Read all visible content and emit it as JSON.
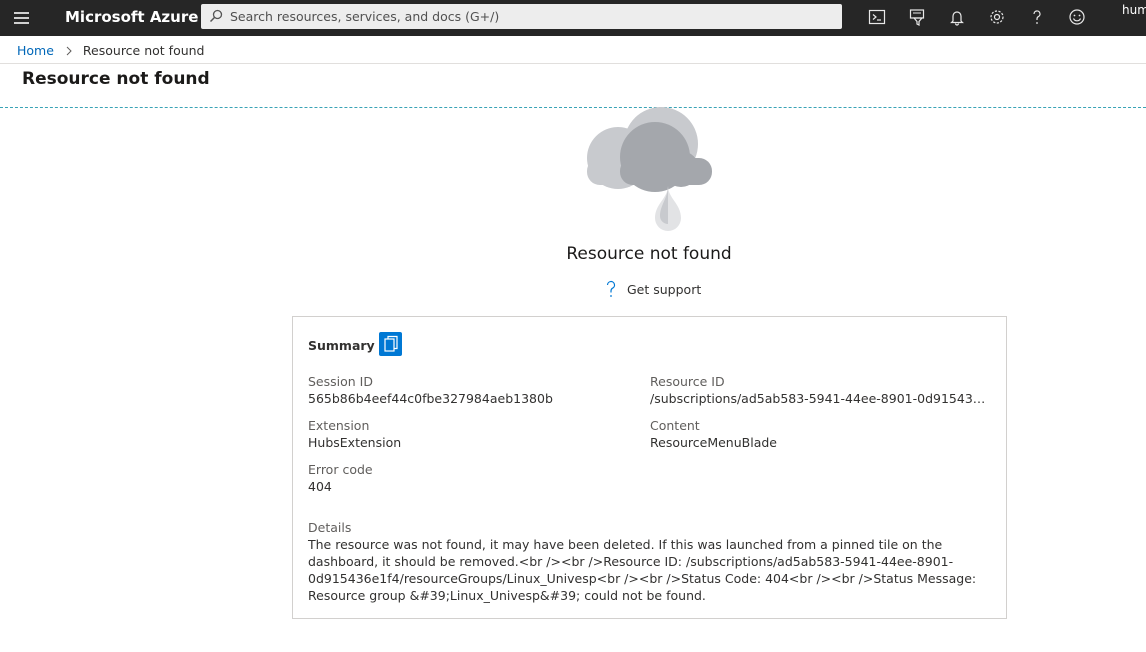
{
  "topbar": {
    "brand": "Microsoft Azure",
    "search_placeholder": "Search resources, services, and docs (G+/)",
    "user": "hum",
    "colors": {
      "bar": "#262626",
      "search": "#ededed"
    },
    "icons": [
      "menu-icon",
      "cloud-shell-icon",
      "directory-filter-icon",
      "notifications-icon",
      "settings-icon",
      "help-icon",
      "feedback-icon"
    ]
  },
  "breadcrumb": {
    "home": "Home",
    "current": "Resource not found"
  },
  "page": {
    "title": "Resource not found"
  },
  "error": {
    "heading": "Resource not found",
    "support_label": "Get support"
  },
  "summary": {
    "title": "Summary",
    "session_id_label": "Session ID",
    "session_id": "565b86b4eef44c0fbe327984aeb1380b",
    "resource_id_label": "Resource ID",
    "resource_id": "/subscriptions/ad5ab583-5941-44ee-8901-0d915436e1f...",
    "extension_label": "Extension",
    "extension": "HubsExtension",
    "content_label": "Content",
    "content": "ResourceMenuBlade",
    "error_code_label": "Error code",
    "error_code": "404",
    "details_label": "Details",
    "details": "The resource was not found, it may have been deleted. If this was launched from a pinned tile on the dashboard, it should be removed.<br /><br />Resource ID: /subscriptions/ad5ab583-5941-44ee-8901-0d915436e1f4/resourceGroups/Linux_Univesp<br /><br />Status Code: 404<br /><br />Status Message: Resource group &#39;Linux_Univesp&#39; could not be found.",
    "accent": "#0078d4"
  }
}
